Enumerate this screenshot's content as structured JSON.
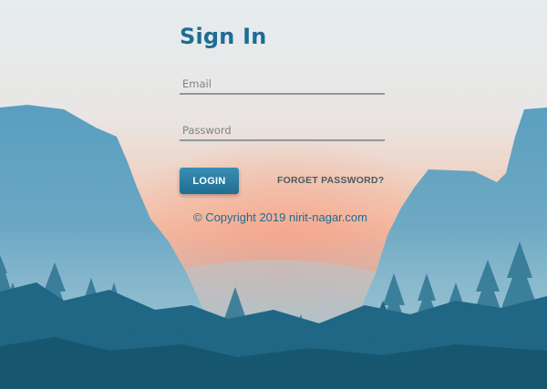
{
  "form": {
    "title": "Sign In",
    "email_placeholder": "Email",
    "password_placeholder": "Password",
    "login_label": "LOGIN",
    "forget_password_label": "FORGET PASSWORD?",
    "copyright": "© Copyright 2019 nirit-nagar.com"
  },
  "colors": {
    "accent": "#1d6d94",
    "button": "#2d7ea4",
    "underline": "#8e979d",
    "link": "#4c5a63"
  },
  "background": {
    "scene": "misty-mountain-valley-forest"
  }
}
